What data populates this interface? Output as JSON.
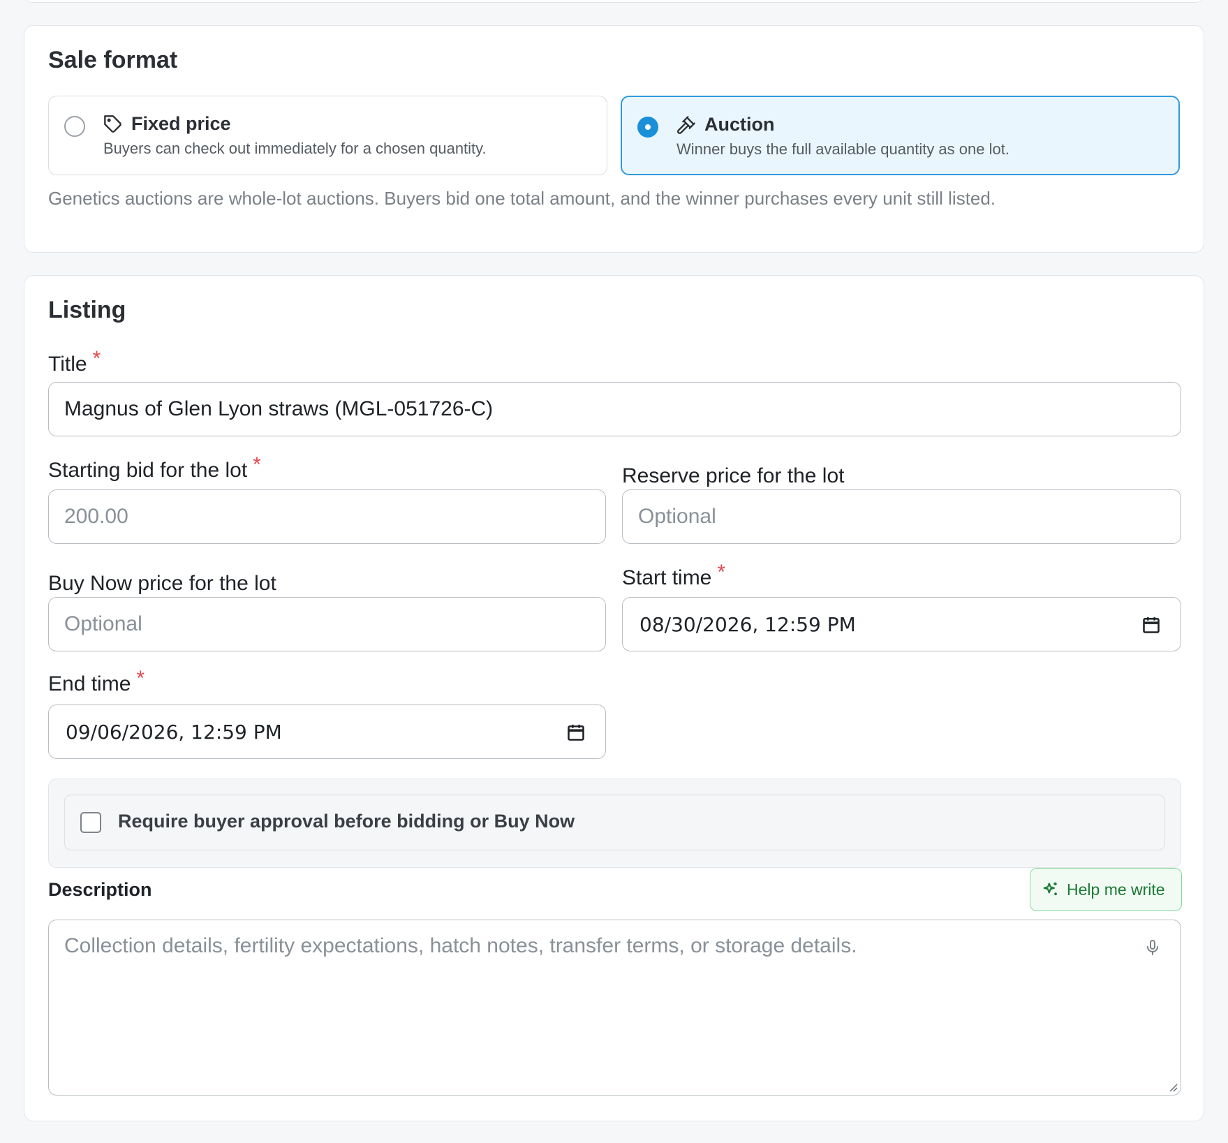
{
  "sale_format": {
    "heading": "Sale format",
    "options": [
      {
        "label": "Fixed price",
        "description": "Buyers can check out immediately for a chosen quantity.",
        "icon": "tag-icon",
        "selected": false
      },
      {
        "label": "Auction",
        "description": "Winner buys the full available quantity as one lot.",
        "icon": "gavel-icon",
        "selected": true
      }
    ],
    "note": "Genetics auctions are whole-lot auctions. Buyers bid one total amount, and the winner purchases every unit still listed."
  },
  "listing": {
    "heading": "Listing",
    "title": {
      "label": "Title",
      "value": "Magnus of Glen Lyon straws (MGL-051726-C)"
    },
    "starting_bid": {
      "label": "Starting bid for the lot",
      "placeholder": "200.00"
    },
    "reserve_price": {
      "label": "Reserve price for the lot",
      "placeholder": "Optional"
    },
    "buy_now": {
      "label": "Buy Now price for the lot",
      "placeholder": "Optional"
    },
    "start_time": {
      "label": "Start time",
      "value": "08/30/2026, 12:59 PM"
    },
    "end_time": {
      "label": "End time",
      "value": "09/06/2026, 12:59 PM"
    },
    "approval": {
      "label": "Require buyer approval before bidding or Buy Now",
      "checked": false
    },
    "description": {
      "label": "Description",
      "help_button": "Help me write",
      "placeholder": "Collection details, fertility expectations, hatch notes, transfer terms, or storage details."
    }
  },
  "required_marker": "*",
  "colors": {
    "accent": "#1b90d8",
    "required": "#e5484d",
    "help_green": "#1c7a35"
  }
}
